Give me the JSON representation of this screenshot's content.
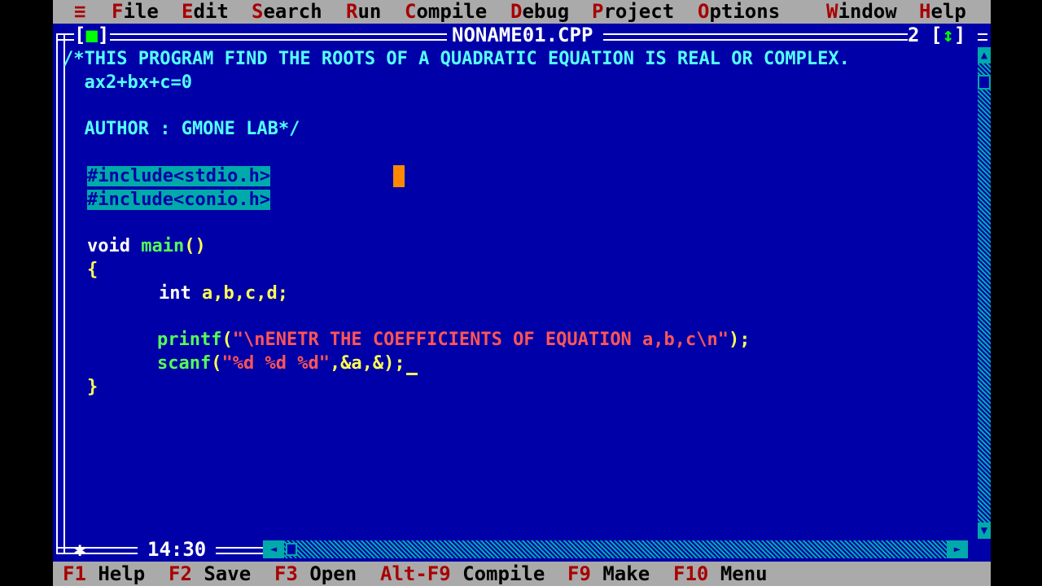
{
  "menu": {
    "system_icon": "≡",
    "items": [
      {
        "hotkey": "F",
        "rest": "ile"
      },
      {
        "hotkey": "E",
        "rest": "dit"
      },
      {
        "hotkey": "S",
        "rest": "earch"
      },
      {
        "hotkey": "R",
        "rest": "un"
      },
      {
        "hotkey": "C",
        "rest": "ompile"
      },
      {
        "hotkey": "D",
        "rest": "ebug"
      },
      {
        "hotkey": "P",
        "rest": "roject"
      },
      {
        "hotkey": "O",
        "rest": "ptions"
      },
      {
        "hotkey": "W",
        "rest": "indow"
      },
      {
        "hotkey": "H",
        "rest": "elp"
      }
    ]
  },
  "window": {
    "title": "NONAME01.CPP",
    "number": "2",
    "close_box": "[■]",
    "zoom_box": "[↕]",
    "cursor_position": "14:30"
  },
  "code": {
    "comment_line1": "/*THIS PROGRAM FIND THE ROOTS OF A QUADRATIC EQUATION IS REAL OR COMPLEX.",
    "comment_line2": "  ax2+bx+c=0",
    "comment_line3": "  AUTHOR : GMONE LAB*/",
    "include1": "#include<stdio.h>",
    "include2": "#include<conio.h>",
    "void_kw": "void",
    "main_fn": "main",
    "main_parens": "()",
    "open_brace": "{",
    "int_kw": "int",
    "int_vars": "a,b,c,d;",
    "printf_fn": "printf",
    "printf_open": "(",
    "printf_str": "\"\\nENETR THE COEFFICIENTS OF EQUATION a,b,c\\n\"",
    "printf_close": ");",
    "scanf_fn": "scanf",
    "scanf_open": "(",
    "scanf_str": "\"%d %d %d\"",
    "scanf_args": ",&a,&);",
    "close_brace": "}"
  },
  "status": {
    "items": [
      {
        "key": "F1",
        "label": "Help"
      },
      {
        "key": "F2",
        "label": "Save"
      },
      {
        "key": "F3",
        "label": "Open"
      },
      {
        "key": "Alt-F9",
        "label": "Compile"
      },
      {
        "key": "F9",
        "label": "Make"
      },
      {
        "key": "F10",
        "label": "Menu"
      }
    ]
  },
  "colors": {
    "editor_bg": "#0000a8",
    "menu_bg": "#aaaaaa",
    "hotkey": "#a80000",
    "comment": "#55ffff",
    "string": "#ff5555",
    "identifier": "#ffff55",
    "function": "#55ff55",
    "cursor": "#ff8800"
  }
}
